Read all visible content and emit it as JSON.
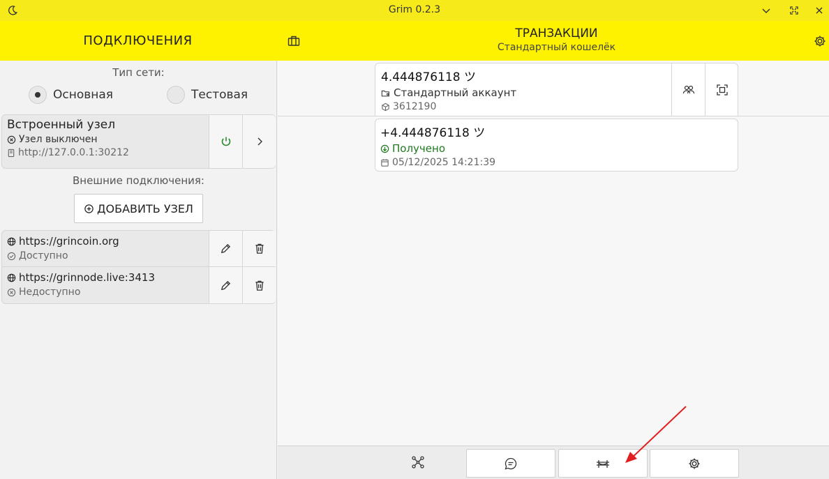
{
  "window": {
    "title": "Grim 0.2.3",
    "theme_icon": "moon-icon",
    "controls": [
      "chevron-down-icon",
      "maximize-icon",
      "close-icon"
    ]
  },
  "header": {
    "left_title": "ПОДКЛЮЧЕНИЯ",
    "wallet_icon": "wallet-icon",
    "title": "ТРАНЗАКЦИИ",
    "subtitle": "Стандартный кошелёк",
    "settings_icon": "gear-icon"
  },
  "connections": {
    "network_type_label": "Тип сети:",
    "network_options": [
      {
        "label": "Основная",
        "selected": true
      },
      {
        "label": "Тестовая",
        "selected": false
      }
    ],
    "integrated_node": {
      "title": "Встроенный узел",
      "status": "Узел выключен",
      "address": "http://127.0.0.1:30212"
    },
    "external_label": "Внешние подключения:",
    "add_node_label": "ДОБАВИТЬ УЗЕЛ",
    "external_nodes": [
      {
        "url": "https://grincoin.org",
        "status": "Доступно"
      },
      {
        "url": "https://grinnode.live:3413",
        "status": "Недоступно"
      }
    ]
  },
  "account": {
    "balance": "4.444876118 ツ",
    "name": "Стандартный аккаунт",
    "height": "3612190"
  },
  "transactions": [
    {
      "amount": "+4.444876118 ツ",
      "status": "Получено",
      "date": "05/12/2025 14:21:39"
    }
  ],
  "colors": {
    "accent_yellow": "#fff200",
    "titlebar_yellow": "#f7ea1b",
    "received_green": "#1e7a1e",
    "power_green": "#2e8b2e",
    "annotation_arrow": "#e02020"
  }
}
